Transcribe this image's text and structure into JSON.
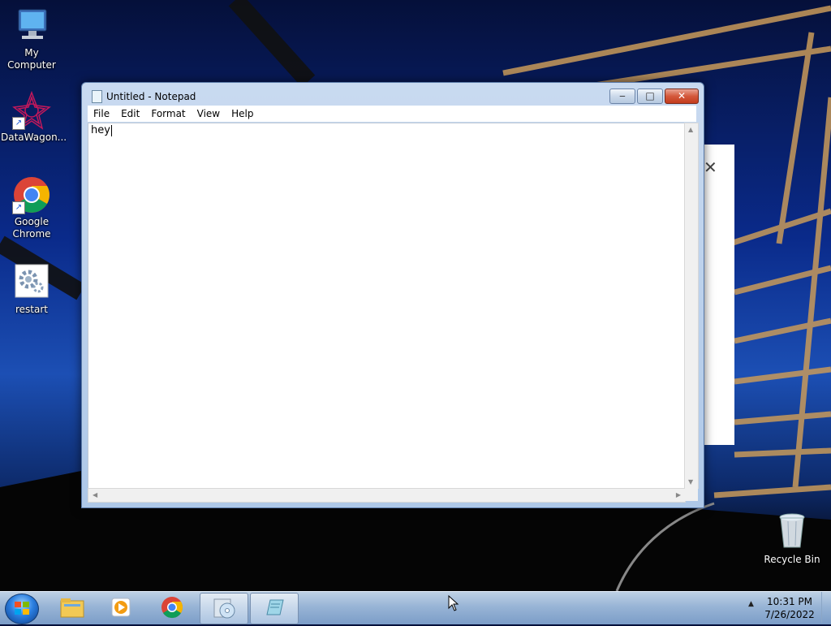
{
  "desktop": {
    "icons": [
      {
        "label": "My Computer",
        "icon": "computer-icon"
      },
      {
        "label": "DataWagon...",
        "icon": "datawagon-icon"
      },
      {
        "label": "Google Chrome",
        "icon": "chrome-icon"
      },
      {
        "label": "restart",
        "icon": "restart-gear-icon"
      }
    ],
    "recycle_bin": {
      "label": "Recycle Bin",
      "icon": "recycle-bin-icon"
    }
  },
  "background_panel": {
    "close_glyph": "✕"
  },
  "notepad": {
    "title": "Untitled - Notepad",
    "menu": [
      "File",
      "Edit",
      "Format",
      "View",
      "Help"
    ],
    "content": "hey",
    "buttons": {
      "minimize": "‒",
      "maximize": "□",
      "close": "✕"
    }
  },
  "taskbar": {
    "items": [
      {
        "icon": "explorer-folder-icon",
        "active": false
      },
      {
        "icon": "media-player-icon",
        "active": false
      },
      {
        "icon": "chrome-icon",
        "active": false
      },
      {
        "icon": "disc-utility-icon",
        "active": true
      },
      {
        "icon": "notepad-icon",
        "active": true
      }
    ],
    "tray_arrow": "▲",
    "clock": {
      "time": "10:31 PM",
      "date": "7/26/2022"
    }
  }
}
